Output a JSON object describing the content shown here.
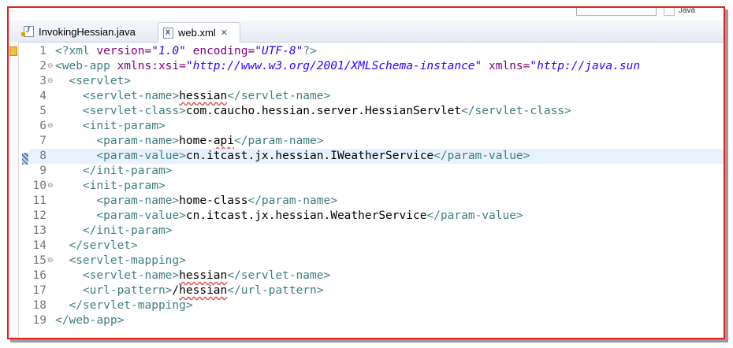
{
  "tabs": [
    {
      "label": "InvokingHessian.java",
      "icon": "java-file-icon",
      "active": false
    },
    {
      "label": "web.xml",
      "icon": "xml-file-icon",
      "active": true
    }
  ],
  "top_strip": {
    "perspective": "Java"
  },
  "colors": {
    "tag": "#3f7f7f",
    "attr": "#7f007f",
    "value": "#2a00ff",
    "text": "#000000",
    "frame": "#e02020"
  },
  "lines": [
    {
      "n": "1",
      "fold": false,
      "segs": [
        [
          "t",
          "<?"
        ],
        [
          "t",
          "xml "
        ],
        [
          "a",
          "version="
        ],
        [
          "v",
          "\"1.0\""
        ],
        [
          "a",
          " encoding="
        ],
        [
          "v",
          "\"UTF-8\""
        ],
        [
          "t",
          "?>"
        ]
      ]
    },
    {
      "n": "2",
      "fold": true,
      "segs": [
        [
          "t",
          "<web-app "
        ],
        [
          "a",
          "xmlns:xsi="
        ],
        [
          "v",
          "\"http://www.w3.org/2001/XMLSchema-instance\""
        ],
        [
          "a",
          " xmlns="
        ],
        [
          "v",
          "\"http://java.sun"
        ]
      ]
    },
    {
      "n": "3",
      "fold": true,
      "segs": [
        [
          "c",
          "  "
        ],
        [
          "t",
          "<servlet>"
        ]
      ]
    },
    {
      "n": "4",
      "fold": false,
      "segs": [
        [
          "c",
          "    "
        ],
        [
          "t",
          "<servlet-name>"
        ],
        [
          "sq",
          "hessian"
        ],
        [
          "t",
          "</servlet-name>"
        ]
      ]
    },
    {
      "n": "5",
      "fold": false,
      "segs": [
        [
          "c",
          "    "
        ],
        [
          "t",
          "<servlet-class>"
        ],
        [
          "c",
          "com.caucho.hessian.server.HessianServlet"
        ],
        [
          "t",
          "</servlet-class>"
        ]
      ]
    },
    {
      "n": "6",
      "fold": true,
      "segs": [
        [
          "c",
          "    "
        ],
        [
          "t",
          "<init-param>"
        ]
      ]
    },
    {
      "n": "7",
      "fold": false,
      "segs": [
        [
          "c",
          "      "
        ],
        [
          "t",
          "<param-name>"
        ],
        [
          "c",
          "home-"
        ],
        [
          "sq",
          "api"
        ],
        [
          "t",
          "</param-name>"
        ]
      ]
    },
    {
      "n": "8",
      "fold": false,
      "current": true,
      "segs": [
        [
          "c",
          "      "
        ],
        [
          "t",
          "<param-value>"
        ],
        [
          "c",
          "cn.itcast.jx.hessian.IWeatherService"
        ],
        [
          "t",
          "</param-value>"
        ]
      ]
    },
    {
      "n": "9",
      "fold": false,
      "segs": [
        [
          "c",
          "    "
        ],
        [
          "t",
          "</init-param>"
        ]
      ]
    },
    {
      "n": "10",
      "fold": true,
      "segs": [
        [
          "c",
          "    "
        ],
        [
          "t",
          "<init-param>"
        ]
      ]
    },
    {
      "n": "11",
      "fold": false,
      "segs": [
        [
          "c",
          "      "
        ],
        [
          "t",
          "<param-name>"
        ],
        [
          "c",
          "home-class"
        ],
        [
          "t",
          "</param-name>"
        ]
      ]
    },
    {
      "n": "12",
      "fold": false,
      "segs": [
        [
          "c",
          "      "
        ],
        [
          "t",
          "<param-value>"
        ],
        [
          "c",
          "cn.itcast.jx.hessian.WeatherService"
        ],
        [
          "t",
          "</param-value>"
        ]
      ]
    },
    {
      "n": "13",
      "fold": false,
      "segs": [
        [
          "c",
          "    "
        ],
        [
          "t",
          "</init-param>"
        ]
      ]
    },
    {
      "n": "14",
      "fold": false,
      "segs": [
        [
          "c",
          "  "
        ],
        [
          "t",
          "</servlet>"
        ]
      ]
    },
    {
      "n": "15",
      "fold": true,
      "segs": [
        [
          "c",
          "  "
        ],
        [
          "t",
          "<servlet-mapping>"
        ]
      ]
    },
    {
      "n": "16",
      "fold": false,
      "segs": [
        [
          "c",
          "    "
        ],
        [
          "t",
          "<servlet-name>"
        ],
        [
          "sq",
          "hessian"
        ],
        [
          "t",
          "</servlet-name>"
        ]
      ]
    },
    {
      "n": "17",
      "fold": false,
      "segs": [
        [
          "c",
          "    "
        ],
        [
          "t",
          "<url-pattern>"
        ],
        [
          "c",
          "/"
        ],
        [
          "sq",
          "hessian"
        ],
        [
          "t",
          "</url-pattern>"
        ]
      ]
    },
    {
      "n": "18",
      "fold": false,
      "segs": [
        [
          "c",
          "  "
        ],
        [
          "t",
          "</servlet-mapping>"
        ]
      ]
    },
    {
      "n": "19",
      "fold": false,
      "segs": [
        [
          "t",
          "</web-app>"
        ]
      ]
    }
  ]
}
